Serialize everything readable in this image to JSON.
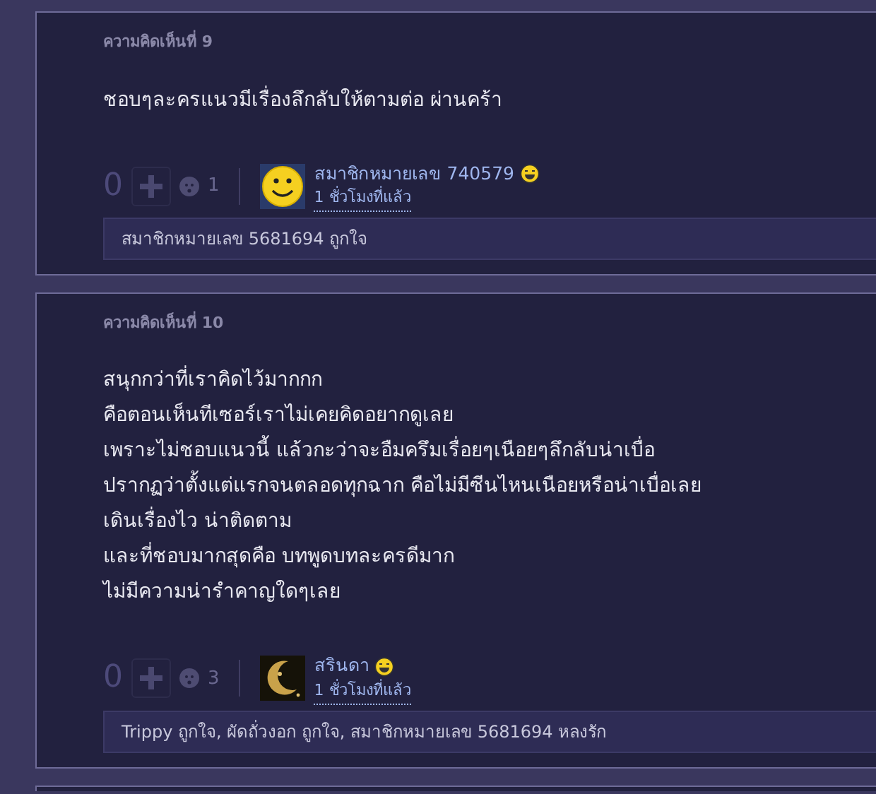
{
  "comments": [
    {
      "label": "ความคิดเห็นที่ 9",
      "text": "ชอบๆละครแนวมีเรื่องลึกลับให้ตามต่อ ผ่านคร้า",
      "score": "0",
      "emotion_count": "1",
      "kind": "smiley",
      "author": "สมาชิกหมายเลข 740579",
      "time": "1 ชั่วโมงที่แล้ว",
      "reactions": "สมาชิกหมายเลข 5681694 ถูกใจ"
    },
    {
      "label": "ความคิดเห็นที่ 10",
      "text": "สนุกกว่าที่เราคิดไว้มากกก\nคือตอนเห็นทีเซอร์เราไม่เคยคิดอยากดูเลย\nเพราะไม่ชอบแนวนี้ แล้วกะว่าจะอืมครึมเรื่อยๆเนือยๆลึกลับน่าเบื่อ\nปรากฏว่าตั้งแต่แรกจนตลอดทุกฉาก คือไม่มีซีนไหนเนือยหรือน่าเบื่อเลย\nเดินเรื่องไว น่าติดตาม\nและที่ชอบมากสุดคือ บทพูดบทละครดีมาก\nไม่มีความน่ารำคาญใดๆเลย",
      "score": "0",
      "emotion_count": "3",
      "kind": "moon",
      "author": "สรินดา",
      "time": "1 ชั่วโมงที่แล้ว",
      "reactions": "Trippy ถูกใจ, ผัดถั่วงอก ถูกใจ, สมาชิกหมายเลข 5681694 หลงรัก"
    }
  ]
}
